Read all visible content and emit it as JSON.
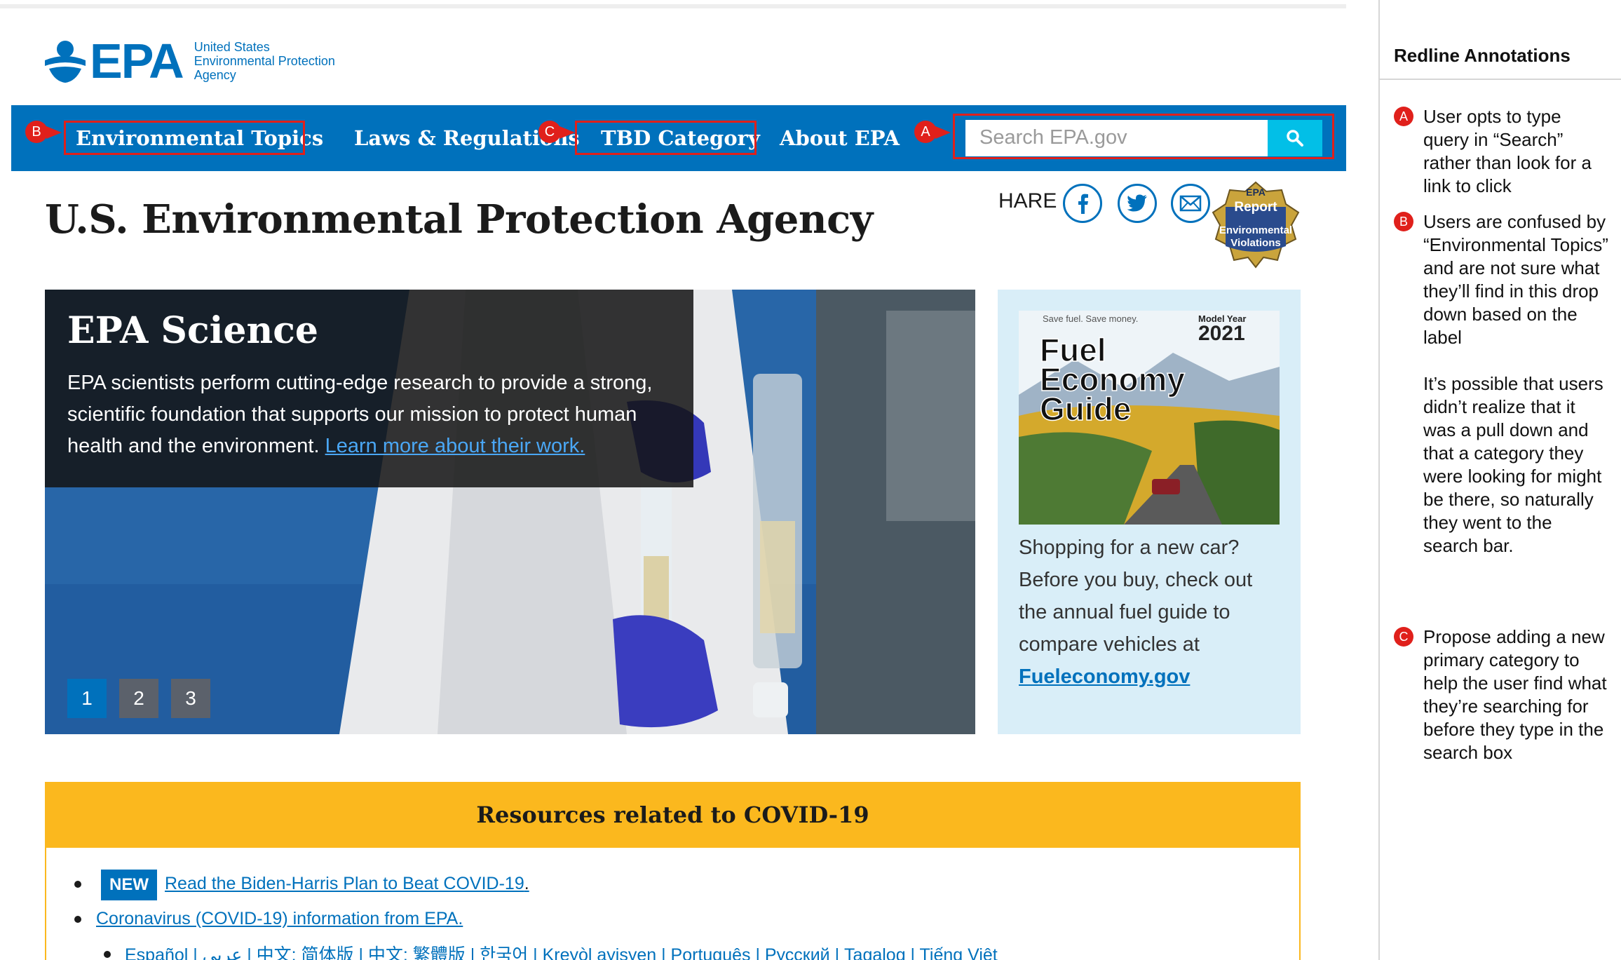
{
  "header": {
    "logo_word": "EPA",
    "logo_sub_1": "United States",
    "logo_sub_2": "Environmental Protection",
    "logo_sub_3": "Agency"
  },
  "nav": {
    "items": [
      "Environmental Topics",
      "Laws & Regulations",
      "TBD Category",
      "About EPA"
    ],
    "search_placeholder": "Search EPA.gov"
  },
  "markers": {
    "a": "A",
    "b": "B",
    "c": "C"
  },
  "page_title": "U.S. Environmental Protection Agency",
  "share": {
    "label": "HARE",
    "badge_line_1": "EPA",
    "badge_line_2": "Report",
    "badge_line_3": "Environmental",
    "badge_line_4": "Violations"
  },
  "hero": {
    "title": "EPA Science",
    "text": "EPA scientists perform cutting-edge research to provide a strong, scientific foundation that supports our mission to protect human health and the environment.",
    "link": "Learn more about their work.",
    "pages": [
      "1",
      "2",
      "3"
    ],
    "active_page": "1"
  },
  "side_ad": {
    "tagline": "Save fuel. Save money.",
    "model_year_label": "Model Year",
    "model_year": "2021",
    "title_1": "Fuel",
    "title_2": "Economy",
    "title_3": "Guide",
    "text": "Shopping for a new car? Before you buy, check out the annual fuel guide to compare vehicles at",
    "link": "Fueleconomy.gov"
  },
  "covid": {
    "heading": "Resources related to COVID-19",
    "new_badge": "NEW",
    "item_1": "Read the Biden-Harris Plan to Beat COVID-19",
    "item_1_suffix": ".",
    "item_2": "Coronavirus (COVID-19) information from EPA.",
    "languages": "Español | عربي | 中文: 简体版 | 中文: 繁體版 | 한국어 | Kreyòl ayisyen | Português | Русский | Tagalog | Tiếng Việt"
  },
  "annotations": {
    "title": "Redline Annotations",
    "a_text": "User opts to type query in “Search” rather than look for a link to click",
    "b_text": "Users are confused by “Environmental Topics” and are not sure what they’ll find in this drop down based on the label",
    "b_text_2": "It’s possible that users didn’t realize that it was a pull down and that a category they were looking for might be there, so naturally they went to the search bar.",
    "c_text": "Propose adding a new primary category to help the user find what they’re searching for before they type in the search box"
  },
  "colors": {
    "brand_blue": "#0071bc",
    "redline": "#e0201b",
    "covid_yellow": "#fbb81e",
    "search_button": "#02bfe7"
  }
}
